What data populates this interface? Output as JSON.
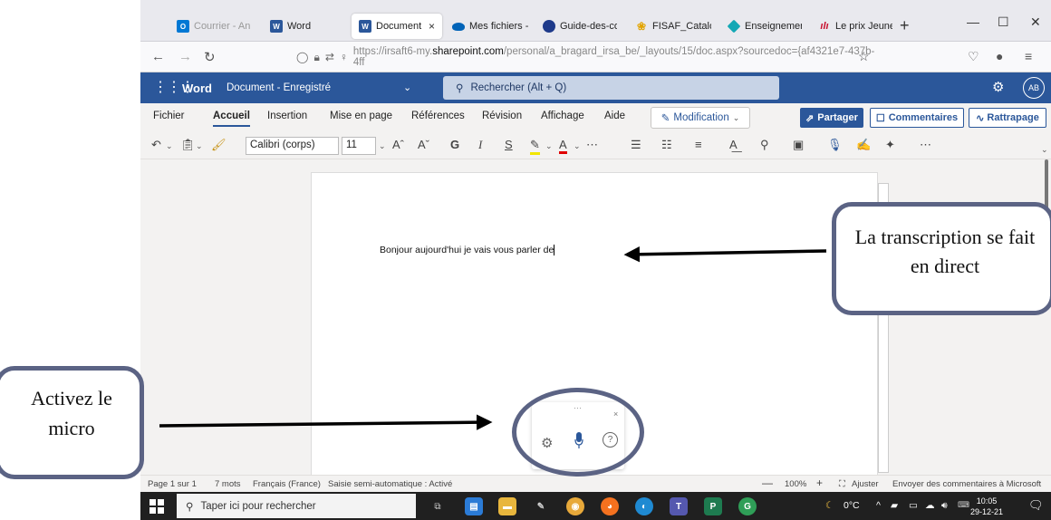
{
  "browser": {
    "tabs": [
      {
        "label": "Courrier - Anne",
        "color": "#0078d4",
        "glyph": "O"
      },
      {
        "label": "Word",
        "color": "#2b579a",
        "glyph": "W"
      },
      {
        "label": "Document.do",
        "color": "#2b579a",
        "glyph": "W",
        "close": "×"
      },
      {
        "label": "Mes fichiers - O",
        "color": "#0364b8",
        "glyph": ""
      },
      {
        "label": "Guide-des-com",
        "color": "#1e3a8a",
        "glyph": ""
      },
      {
        "label": "FISAF_Catalogu",
        "color": "#ffd54f",
        "glyph": ""
      },
      {
        "label": "Enseignement e",
        "color": "#13a8b5",
        "glyph": ""
      },
      {
        "label": "Le prix Jeunesse",
        "color": "#c8102e",
        "glyph": ""
      }
    ],
    "new_tab": "+",
    "window_controls": {
      "minimize": "—",
      "maximize": "☐",
      "close": "✕"
    },
    "url": {
      "prefix": "https://irsaft6-my.",
      "domain": "sharepoint.com",
      "path": "/personal/a_bragard_irsa_be/_layouts/15/doc.aspx?sourcedoc={af4321e7-437b-4ff"
    }
  },
  "word": {
    "app_name": "Word",
    "doc_title": "Document - Enregistré",
    "search_placeholder": "Rechercher (Alt + Q)",
    "avatar_initials": "AB",
    "accent": "#2b579a"
  },
  "ribbon": {
    "tabs": [
      "Fichier",
      "Accueil",
      "Insertion",
      "Mise en page",
      "Références",
      "Révision",
      "Affichage",
      "Aide"
    ],
    "active_tab": "Accueil",
    "mode_button": "Modification",
    "share_button": "Partager",
    "comments_button": "Commentaires",
    "catchup_button": "Rattrapage"
  },
  "toolbar": {
    "font_name": "Calibri (corps)",
    "font_size": "11",
    "bold": "G",
    "italic": "I",
    "underline": "S"
  },
  "document": {
    "text": "Bonjour aujourd'hui je vais vous parler de"
  },
  "dictation": {
    "menu": "⋯",
    "close": "×",
    "help": "?"
  },
  "status_bar": {
    "page": "Page 1 sur 1",
    "words": "7 mots",
    "language": "Français (France)",
    "autosave": "Saisie semi-automatique : Activé",
    "zoom": "100%",
    "fit": "Ajuster",
    "feedback": "Envoyer des commentaires à Microsoft"
  },
  "taskbar": {
    "search_placeholder": "Taper ici pour rechercher",
    "temperature": "0°C",
    "time": "10:05",
    "date": "29-12-21"
  },
  "annotations": {
    "right_callout": "La transcription se fait en direct",
    "left_callout": "Activez le micro",
    "border_color": "#5b6384"
  }
}
